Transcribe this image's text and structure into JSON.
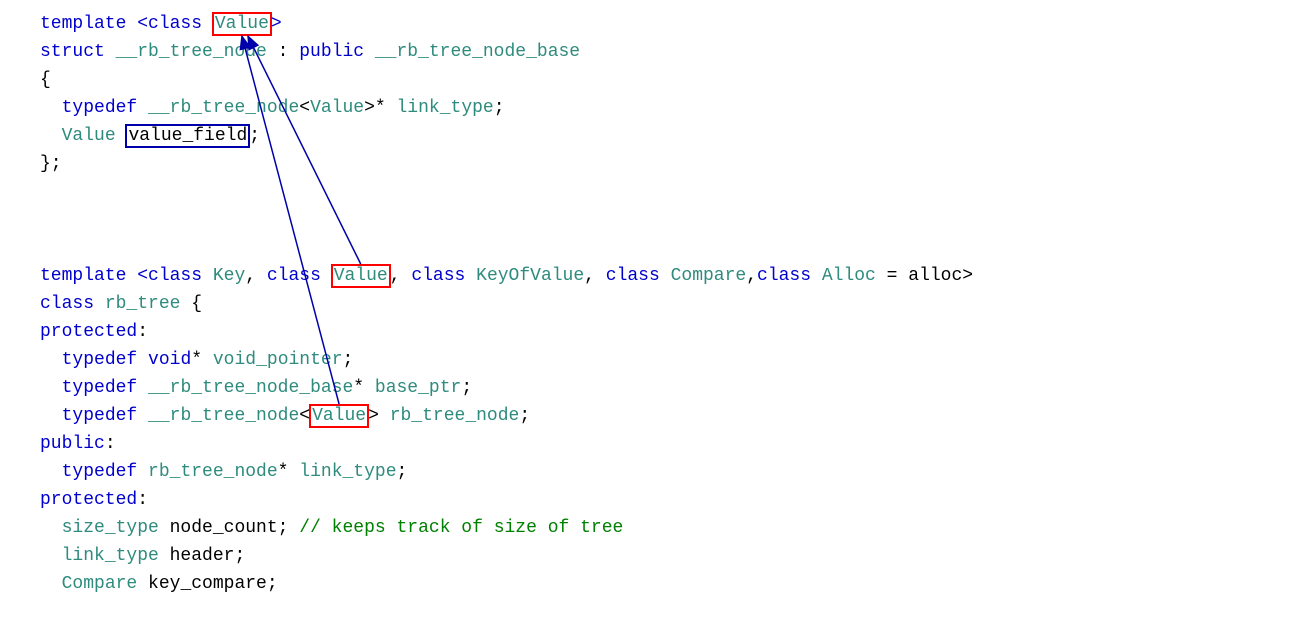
{
  "code": {
    "l1": {
      "a": "template <",
      "b": "class",
      "c": " ",
      "d": "Value",
      "e": ">"
    },
    "l2": {
      "a": "struct",
      "b": " __rb_tree_node",
      "c": " : ",
      "d": "public",
      "e": " __rb_tree_node_base"
    },
    "l3": {
      "a": "{"
    },
    "l4": {
      "a": "  ",
      "b": "typedef",
      "c": " __rb_tree_node",
      "d": "<",
      "e": "Value",
      "f": ">*",
      "g": " link_type",
      "h": ";"
    },
    "l5": {
      "a": "  ",
      "b": "Value",
      "c": " ",
      "d": "value_field",
      "e": ";"
    },
    "l6": {
      "a": "};"
    },
    "l7": {
      "a": "template <",
      "b": "class",
      "c": " Key",
      "d": ", ",
      "e": "class",
      "f": " ",
      "g": "Value",
      "h": ", ",
      "i": "class",
      "j": " KeyOfValue",
      "k": ", ",
      "l": "class",
      "m": " Compare",
      "n": ",",
      "o": "class",
      "p": " Alloc",
      "q": " = alloc>"
    },
    "l8": {
      "a": "class",
      "b": " rb_tree",
      "c": " {"
    },
    "l9": {
      "a": "protected",
      "b": ":"
    },
    "l10": {
      "a": "  ",
      "b": "typedef",
      "c": " ",
      "d": "void",
      "e": "*",
      "f": " void_pointer",
      "g": ";"
    },
    "l11": {
      "a": "  ",
      "b": "typedef",
      "c": " __rb_tree_node_base",
      "d": "*",
      "e": " base_ptr",
      "f": ";"
    },
    "l12": {
      "a": "  ",
      "b": "typedef",
      "c": " __rb_tree_node",
      "d": "<",
      "e": "Value",
      "f": ">",
      "g": " rb_tree_node",
      "h": ";"
    },
    "l13": {
      "a": "public",
      "b": ":"
    },
    "l14": {
      "a": "  ",
      "b": "typedef",
      "c": " rb_tree_node",
      "d": "*",
      "e": " link_type",
      "f": ";"
    },
    "l15": {
      "a": "protected",
      "b": ":"
    },
    "l16": {
      "a": "  ",
      "b": "size_type",
      "c": " node_count; ",
      "d": "// keeps track of size of tree"
    },
    "l17": {
      "a": "  ",
      "b": "link_type",
      "c": " header;"
    },
    "l18": {
      "a": "  ",
      "b": "Compare",
      "c": " key_compare;"
    }
  },
  "annotations": {
    "highlights": [
      {
        "target": "Value",
        "line": 1,
        "style": "red-box"
      },
      {
        "target": "value_field",
        "line": 5,
        "style": "blue-box"
      },
      {
        "target": "Value",
        "line": 7,
        "style": "red-box"
      },
      {
        "target": "Value",
        "line": 12,
        "style": "red-box"
      }
    ],
    "arrows": [
      {
        "from": "Value-line12",
        "to": "Value-line1",
        "color": "#0000aa"
      },
      {
        "from": "Value-line7",
        "to": "Value-line1",
        "color": "#0000aa"
      }
    ]
  }
}
